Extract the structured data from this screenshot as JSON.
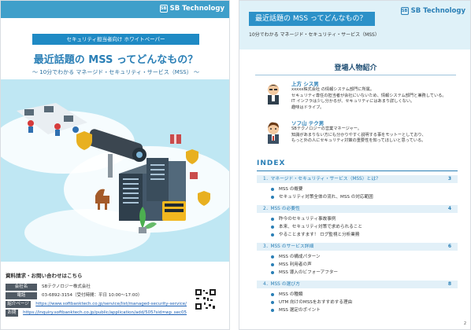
{
  "left": {
    "logo": "SB Technology",
    "tagline": "セキュリティ担当者向け ホワイトペーパー",
    "title": "最近話題の MSS ってどんなもの？",
    "subtitle": "〜 10分でわかる マネージド・セキュリティ・サービス（MSS） 〜",
    "contact_heading": "資料請求・お問い合わせはこちら",
    "contacts": [
      {
        "label": "会社名",
        "value": "SBテクノロジー株式会社"
      },
      {
        "label": "電話",
        "value": "03-6892-3154（受付時間：平日 10:00〜17:00）"
      },
      {
        "label": "紹介ページ",
        "value": "https://www.softbanktech.co.jp/service/list/managed-security-service/"
      },
      {
        "label": "お問い合わせ",
        "value": "https://inquiry.softbanktech.co.jp/public/application/add/505?sid=wp_sec05"
      }
    ]
  },
  "right": {
    "title": "最近話題の MSS ってどんなもの？",
    "subtitle": "10分でわかる マネージド・セキュリティ・サービス（MSS）",
    "logo": "SB Technology",
    "characters_heading": "登場人物紹介",
    "characters": [
      {
        "name": "上方 シス男",
        "desc": "xxxxx株式会社 の情報システム部門に所属。\nセキュリティ専任の担当者が会社にいないため、情報システム部門と兼務している。\nIT インフラは少し分かるが、セキュリティにはあまり詳しくない。\n趣味はドライブ。"
      },
      {
        "name": "ソフ山 テク男",
        "desc": "SBテクノロジーの営業マネージャー。\n知識があまりない方にも分かりやすく説明する事をモットーとしており、\nもっと外の人にセキュリティ対策の重要性を知ってほしいと思っている。"
      }
    ],
    "index_heading": "INDEX",
    "sections": [
      {
        "title": "1．マネージド・セキュリティ・サービス（MSS）とは？",
        "page": "3",
        "items": [
          "MSS の概要",
          "セキュリティ対策全体の流れ、MSS の対応範囲"
        ]
      },
      {
        "title": "2．MSS の必要性",
        "page": "4",
        "items": [
          "昨今のセキュリティ事故事例",
          "本来、セキュリティ対策で求められること",
          "やることますます！ ログ監視と分析業務"
        ]
      },
      {
        "title": "3．MSS のサービス詳細",
        "page": "6",
        "items": [
          "MSS の構成パターン",
          "MSS 利用者の声",
          "MSS 導入のビフォーアフター"
        ]
      },
      {
        "title": "4．MSS の選び方",
        "page": "8",
        "items": [
          "MSS の種類",
          "UTM 向けのMSSをおすすめする理由",
          "MSS 選定のポイント"
        ]
      }
    ],
    "page_number": "2"
  }
}
